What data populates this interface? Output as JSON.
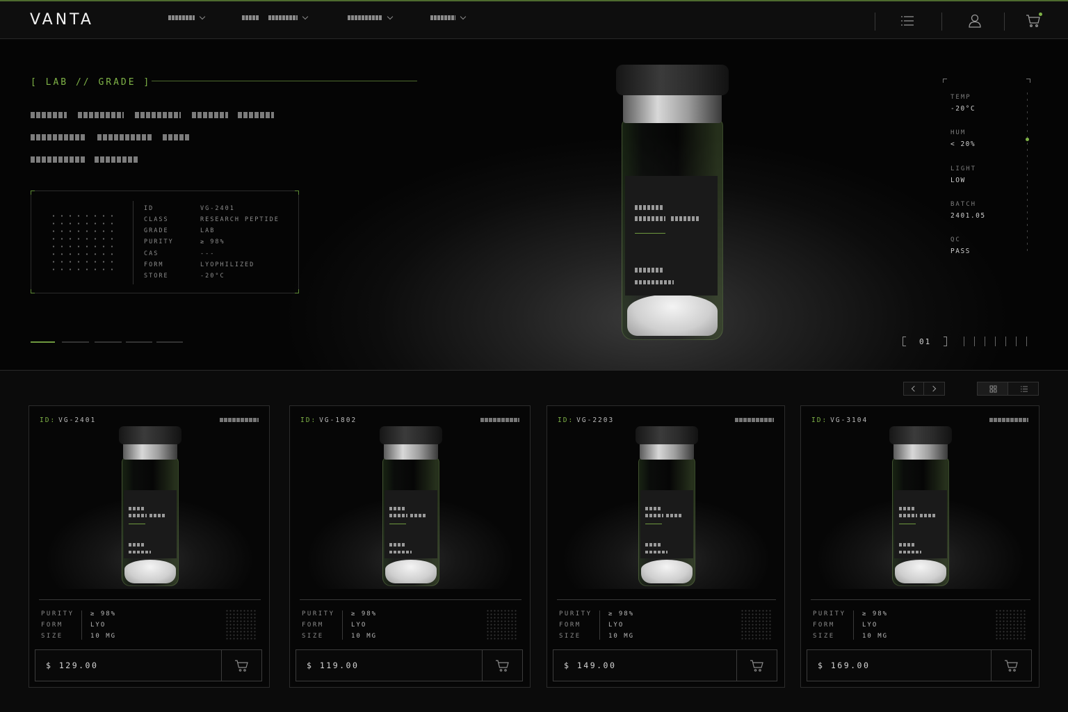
{
  "brand": {
    "name": "VANTA",
    "accent": "#7fb347"
  },
  "nav": {
    "items": [
      {
        "name": "nav-menu-1"
      },
      {
        "name": "nav-menu-2"
      },
      {
        "name": "nav-menu-3"
      },
      {
        "name": "nav-menu-4"
      }
    ],
    "icons": [
      "list-icon",
      "user-icon",
      "cart-icon"
    ]
  },
  "hero": {
    "tag": "[ LAB // GRADE ]",
    "spec": [
      {
        "k": "ID",
        "v": "VG-2401"
      },
      {
        "k": "CLASS",
        "v": "RESEARCH PEPTIDE"
      },
      {
        "k": "GRADE",
        "v": "LAB"
      },
      {
        "k": "PURITY",
        "v": "≥ 98%"
      },
      {
        "k": "CAS",
        "v": "---"
      },
      {
        "k": "FORM",
        "v": "LYOPHILIZED"
      },
      {
        "k": "STORE",
        "v": "-20°C"
      }
    ],
    "environment": [
      {
        "k": "TEMP",
        "v": "-20°C"
      },
      {
        "k": "HUM",
        "v": "< 20%"
      },
      {
        "k": "LIGHT",
        "v": "LOW"
      },
      {
        "k": "BATCH",
        "v": "2401.05"
      },
      {
        "k": "QC",
        "v": "PASS"
      }
    ],
    "slide_index": "01",
    "slide_count": 5,
    "active_slide": 1
  },
  "products": [
    {
      "id_label": "ID:",
      "id": "VG-2401",
      "purity_k": "PURITY",
      "purity": "≥ 98%",
      "form_k": "FORM",
      "form": "LYO",
      "size_k": "SIZE",
      "size": "10 MG",
      "price": "$ 129.00"
    },
    {
      "id_label": "ID:",
      "id": "VG-1802",
      "purity_k": "PURITY",
      "purity": "≥ 98%",
      "form_k": "FORM",
      "form": "LYO",
      "size_k": "SIZE",
      "size": "10 MG",
      "price": "$ 119.00"
    },
    {
      "id_label": "ID:",
      "id": "VG-2203",
      "purity_k": "PURITY",
      "purity": "≥ 98%",
      "form_k": "FORM",
      "form": "LYO",
      "size_k": "SIZE",
      "size": "10 MG",
      "price": "$ 149.00"
    },
    {
      "id_label": "ID:",
      "id": "VG-3104",
      "purity_k": "PURITY",
      "purity": "≥ 98%",
      "form_k": "FORM",
      "form": "LYO",
      "size_k": "SIZE",
      "size": "10 MG",
      "price": "$ 169.00"
    }
  ],
  "view": {
    "mode": "grid"
  }
}
